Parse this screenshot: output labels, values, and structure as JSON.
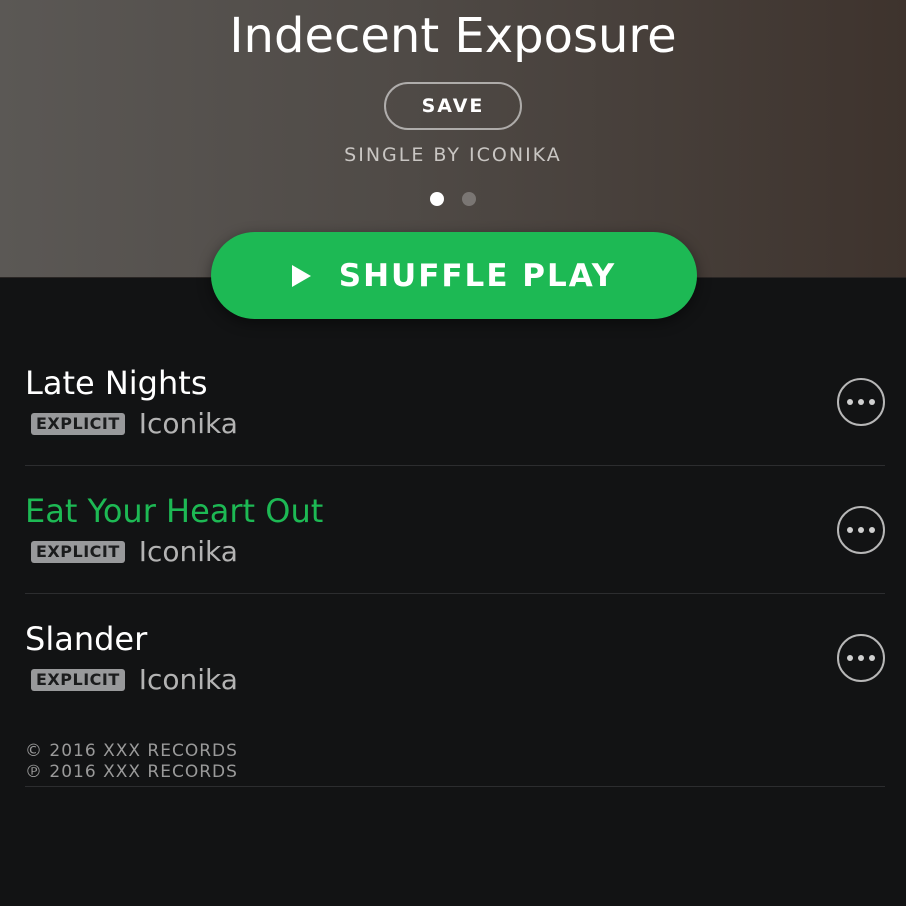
{
  "album": {
    "title": "Indecent Exposure",
    "save_label": "SAVE",
    "subtitle": "SINGLE BY ICONIKA",
    "page_dots": {
      "total": 2,
      "active": 1
    }
  },
  "shuffle": {
    "label": "SHUFFLE PLAY",
    "icon": "play-icon",
    "color": "#1db954"
  },
  "tracks": [
    {
      "title": "Late Nights",
      "badge": "EXPLICIT",
      "artist": "Iconika",
      "playing": false,
      "more_icon": "more-options-icon"
    },
    {
      "title": "Eat Your Heart Out",
      "badge": "EXPLICIT",
      "artist": "Iconika",
      "playing": true,
      "more_icon": "more-options-icon"
    },
    {
      "title": "Slander",
      "badge": "EXPLICIT",
      "artist": "Iconika",
      "playing": false,
      "more_icon": "more-options-icon"
    }
  ],
  "footer": {
    "copyright": "© 2016 XXX RECORDS",
    "phonogram": "℗ 2016 XXX RECORDS"
  },
  "colors": {
    "accent": "#1db954",
    "background": "#121314",
    "text": "#ffffff",
    "secondary_text": "#b3b3b3"
  }
}
